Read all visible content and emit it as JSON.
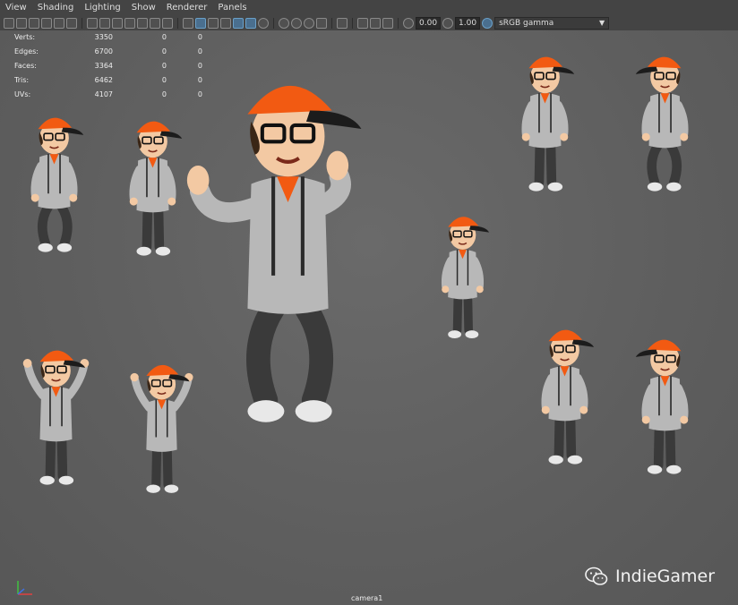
{
  "menu": [
    "View",
    "Shading",
    "Lighting",
    "Show",
    "Renderer",
    "Panels"
  ],
  "toolbar": {
    "exposure_value": "0.00",
    "gamma_value": "1.00",
    "color_space": "sRGB gamma"
  },
  "hud": {
    "rows": [
      {
        "label": "Verts:",
        "c1": "3350",
        "c2": "0",
        "c3": "0"
      },
      {
        "label": "Edges:",
        "c1": "6700",
        "c2": "0",
        "c3": "0"
      },
      {
        "label": "Faces:",
        "c1": "3364",
        "c2": "0",
        "c3": "0"
      },
      {
        "label": "Tris:",
        "c1": "6462",
        "c2": "0",
        "c3": "0"
      },
      {
        "label": "UVs:",
        "c1": "4107",
        "c2": "0",
        "c3": "0"
      }
    ]
  },
  "viewport": {
    "camera_label": "camera1"
  },
  "watermark": {
    "text": "IndieGamer"
  },
  "colors": {
    "cap": "#f25a12",
    "cap_brim": "#1c1c1c",
    "hoodie": "#b8b8b8",
    "pants": "#3a3a3a",
    "skin": "#f3c9a3",
    "hair": "#3a2616"
  }
}
